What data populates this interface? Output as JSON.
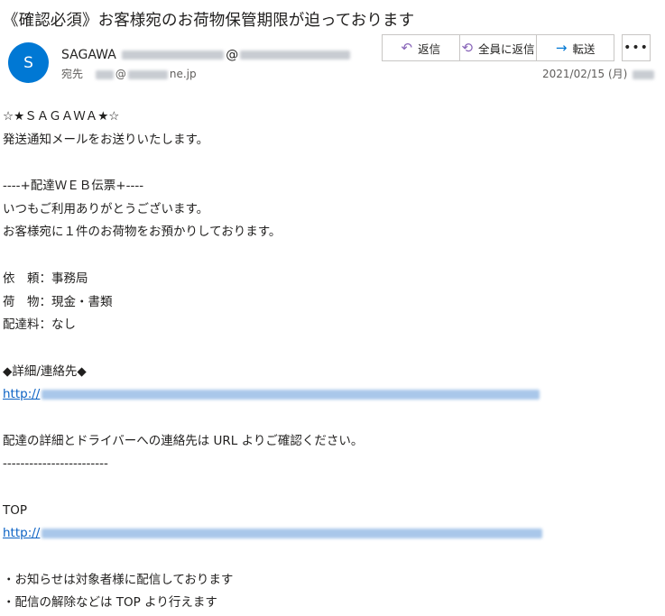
{
  "email": {
    "subject": "《確認必須》お客様宛のお荷物保管期限が迫っております",
    "avatar_initial": "S",
    "sender_name": "SAGAWA",
    "sender_at": "@",
    "to_label": "宛先",
    "to_domain": "ne.jp",
    "to_at": "@",
    "date": "2021/02/15 (月)"
  },
  "toolbar": {
    "reply_label": "返信",
    "reply_all_label": "全員に返信",
    "forward_label": "転送",
    "more_label": "•••"
  },
  "body": {
    "line1": "☆★ＳＡＧＡＷＡ★☆",
    "line2": "発送通知メールをお送りいたします。",
    "line3": "----+配達ＷＥＢ伝票+----",
    "line4": "いつもご利用ありがとうございます。",
    "line5": "お客様宛に１件のお荷物をお預かりしております。",
    "line6": "依　頼：事務局",
    "line7": "荷　物：現金・書類",
    "line8": "配達料：なし",
    "line9": "◆詳細/連絡先◆",
    "link1_prefix": "http://",
    "line10": "配達の詳細とドライバーへの連絡先は URL よりご確認ください。",
    "line11": "------------------------",
    "line12": "TOP",
    "link2_prefix": "http://",
    "line13": "・お知らせは対象者様に配信しております",
    "line14": "・配信の解除などは TOP より行えます"
  },
  "colors": {
    "accent": "#0078d4",
    "reply_icon": "#8764b8",
    "link": "#0b62c4"
  },
  "icons": {
    "reply": "reply-icon",
    "reply_all": "reply-all-icon",
    "forward": "forward-icon",
    "more": "more-icon"
  }
}
